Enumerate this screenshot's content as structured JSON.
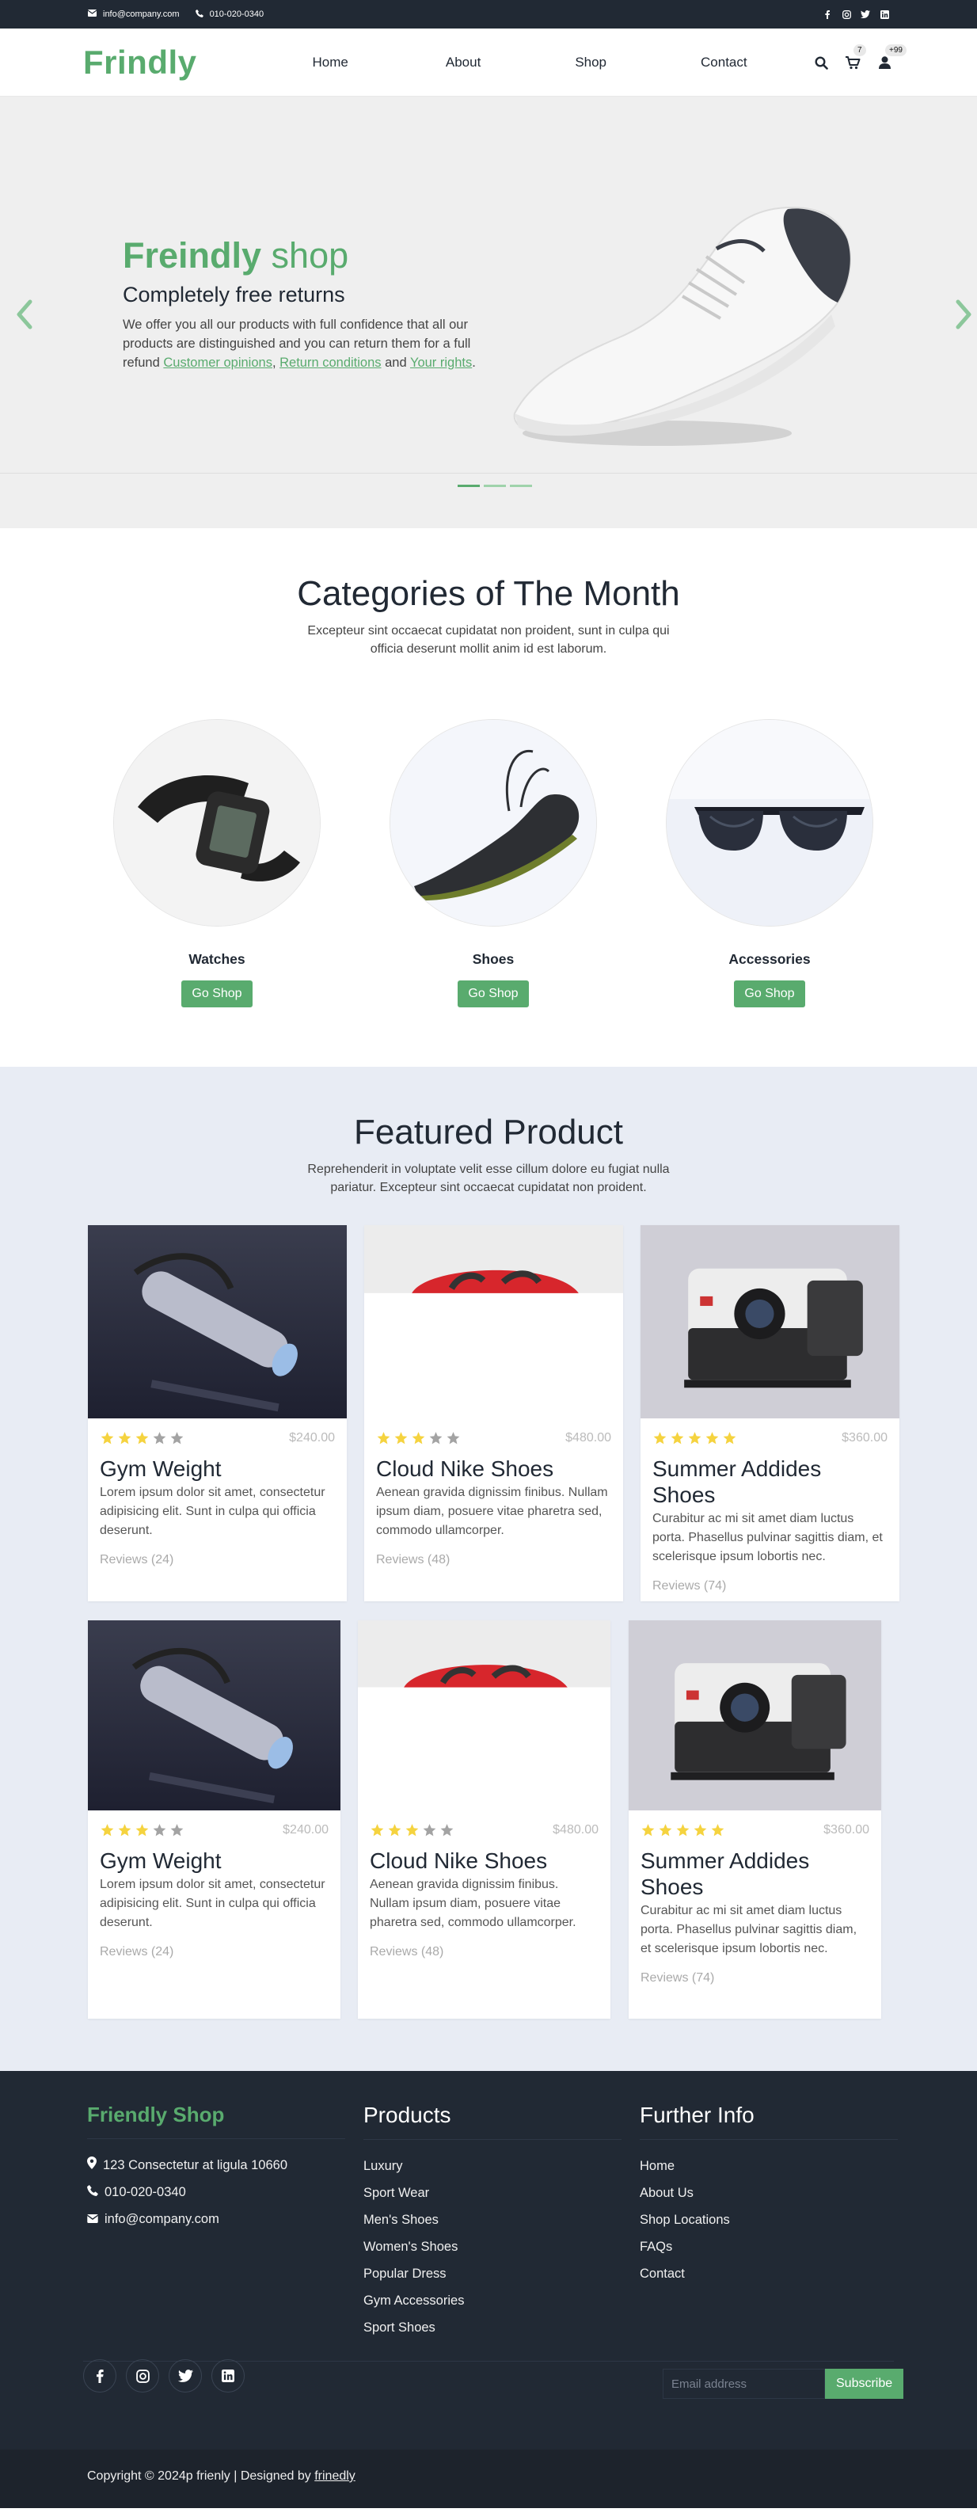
{
  "topbar": {
    "email": "info@company.com",
    "phone": "010-020-0340",
    "social_icons": [
      "facebook-icon",
      "instagram-icon",
      "twitter-icon",
      "linkedin-icon"
    ]
  },
  "header": {
    "logo": "Frindly",
    "nav": [
      "Home",
      "About",
      "Shop",
      "Contact"
    ],
    "cart_count": "7",
    "user_count": "+99"
  },
  "hero": {
    "title_bold": "Freindly",
    "title_light": " shop",
    "subtitle": "Completely free returns",
    "desc_before": "We offer you all our products with full confidence that all our products are distinguished and you can return them for a full refund ",
    "link1": "Customer opinions",
    "sep1": ", ",
    "link2": "Return conditions",
    "sep2": " and ",
    "link3": "Your rights",
    "desc_after": ".",
    "accent": "#59ab6e"
  },
  "categories": {
    "title": "Categories of The Month",
    "desc": "Excepteur sint occaecat cupidatat non proident, sunt in culpa qui officia deserunt mollit anim id est laborum.",
    "items": [
      {
        "name": "Watches",
        "button": "Go Shop"
      },
      {
        "name": "Shoes",
        "button": "Go Shop"
      },
      {
        "name": "Accessories",
        "button": "Go Shop"
      }
    ]
  },
  "featured": {
    "title": "Featured Product",
    "desc": "Reprehenderit in voluptate velit esse cillum dolore eu fugiat nulla pariatur. Excepteur sint occaecat cupidatat non proident.",
    "products": [
      {
        "title": "Gym Weight",
        "price": "$240.00",
        "rating": 3,
        "desc": "Lorem ipsum dolor sit amet, consectetur adipisicing elit. Sunt in culpa qui officia deserunt.",
        "reviews": "Reviews (24)"
      },
      {
        "title": "Cloud Nike Shoes",
        "price": "$480.00",
        "rating": 3,
        "desc": "Aenean gravida dignissim finibus. Nullam ipsum diam, posuere vitae pharetra sed, commodo ullamcorper.",
        "reviews": "Reviews (48)"
      },
      {
        "title": "Summer Addides Shoes",
        "price": "$360.00",
        "rating": 5,
        "desc": "Curabitur ac mi sit amet diam luctus porta. Phasellus pulvinar sagittis diam, et scelerisque ipsum lobortis nec.",
        "reviews": "Reviews (74)"
      },
      {
        "title": "Gym Weight",
        "price": "$240.00",
        "rating": 3,
        "desc": "Lorem ipsum dolor sit amet, consectetur adipisicing elit. Sunt in culpa qui officia deserunt.",
        "reviews": "Reviews (24)"
      },
      {
        "title": "Cloud Nike Shoes",
        "price": "$480.00",
        "rating": 3,
        "desc": "Aenean gravida dignissim finibus. Nullam ipsum diam, posuere vitae pharetra sed, commodo ullamcorper.",
        "reviews": "Reviews (48)"
      },
      {
        "title": "Summer Addides Shoes",
        "price": "$360.00",
        "rating": 5,
        "desc": "Curabitur ac mi sit amet diam luctus porta. Phasellus pulvinar sagittis diam, et scelerisque ipsum lobortis nec.",
        "reviews": "Reviews (74)"
      }
    ]
  },
  "footer": {
    "brand": "Friendly Shop",
    "address": "123 Consectetur at ligula 10660",
    "phone": "010-020-0340",
    "email": "info@company.com",
    "products_title": "Products",
    "products": [
      "Luxury",
      "Sport Wear",
      "Men's Shoes",
      "Women's Shoes",
      "Popular Dress",
      "Gym Accessories",
      "Sport Shoes"
    ],
    "info_title": "Further Info",
    "info": [
      "Home",
      "About Us",
      "Shop Locations",
      "FAQs",
      "Contact"
    ],
    "email_placeholder": "Email address",
    "subscribe": "Subscribe",
    "copyright": "Copyright © 2024p frienly | Designed by ",
    "designer": "frinedly"
  }
}
